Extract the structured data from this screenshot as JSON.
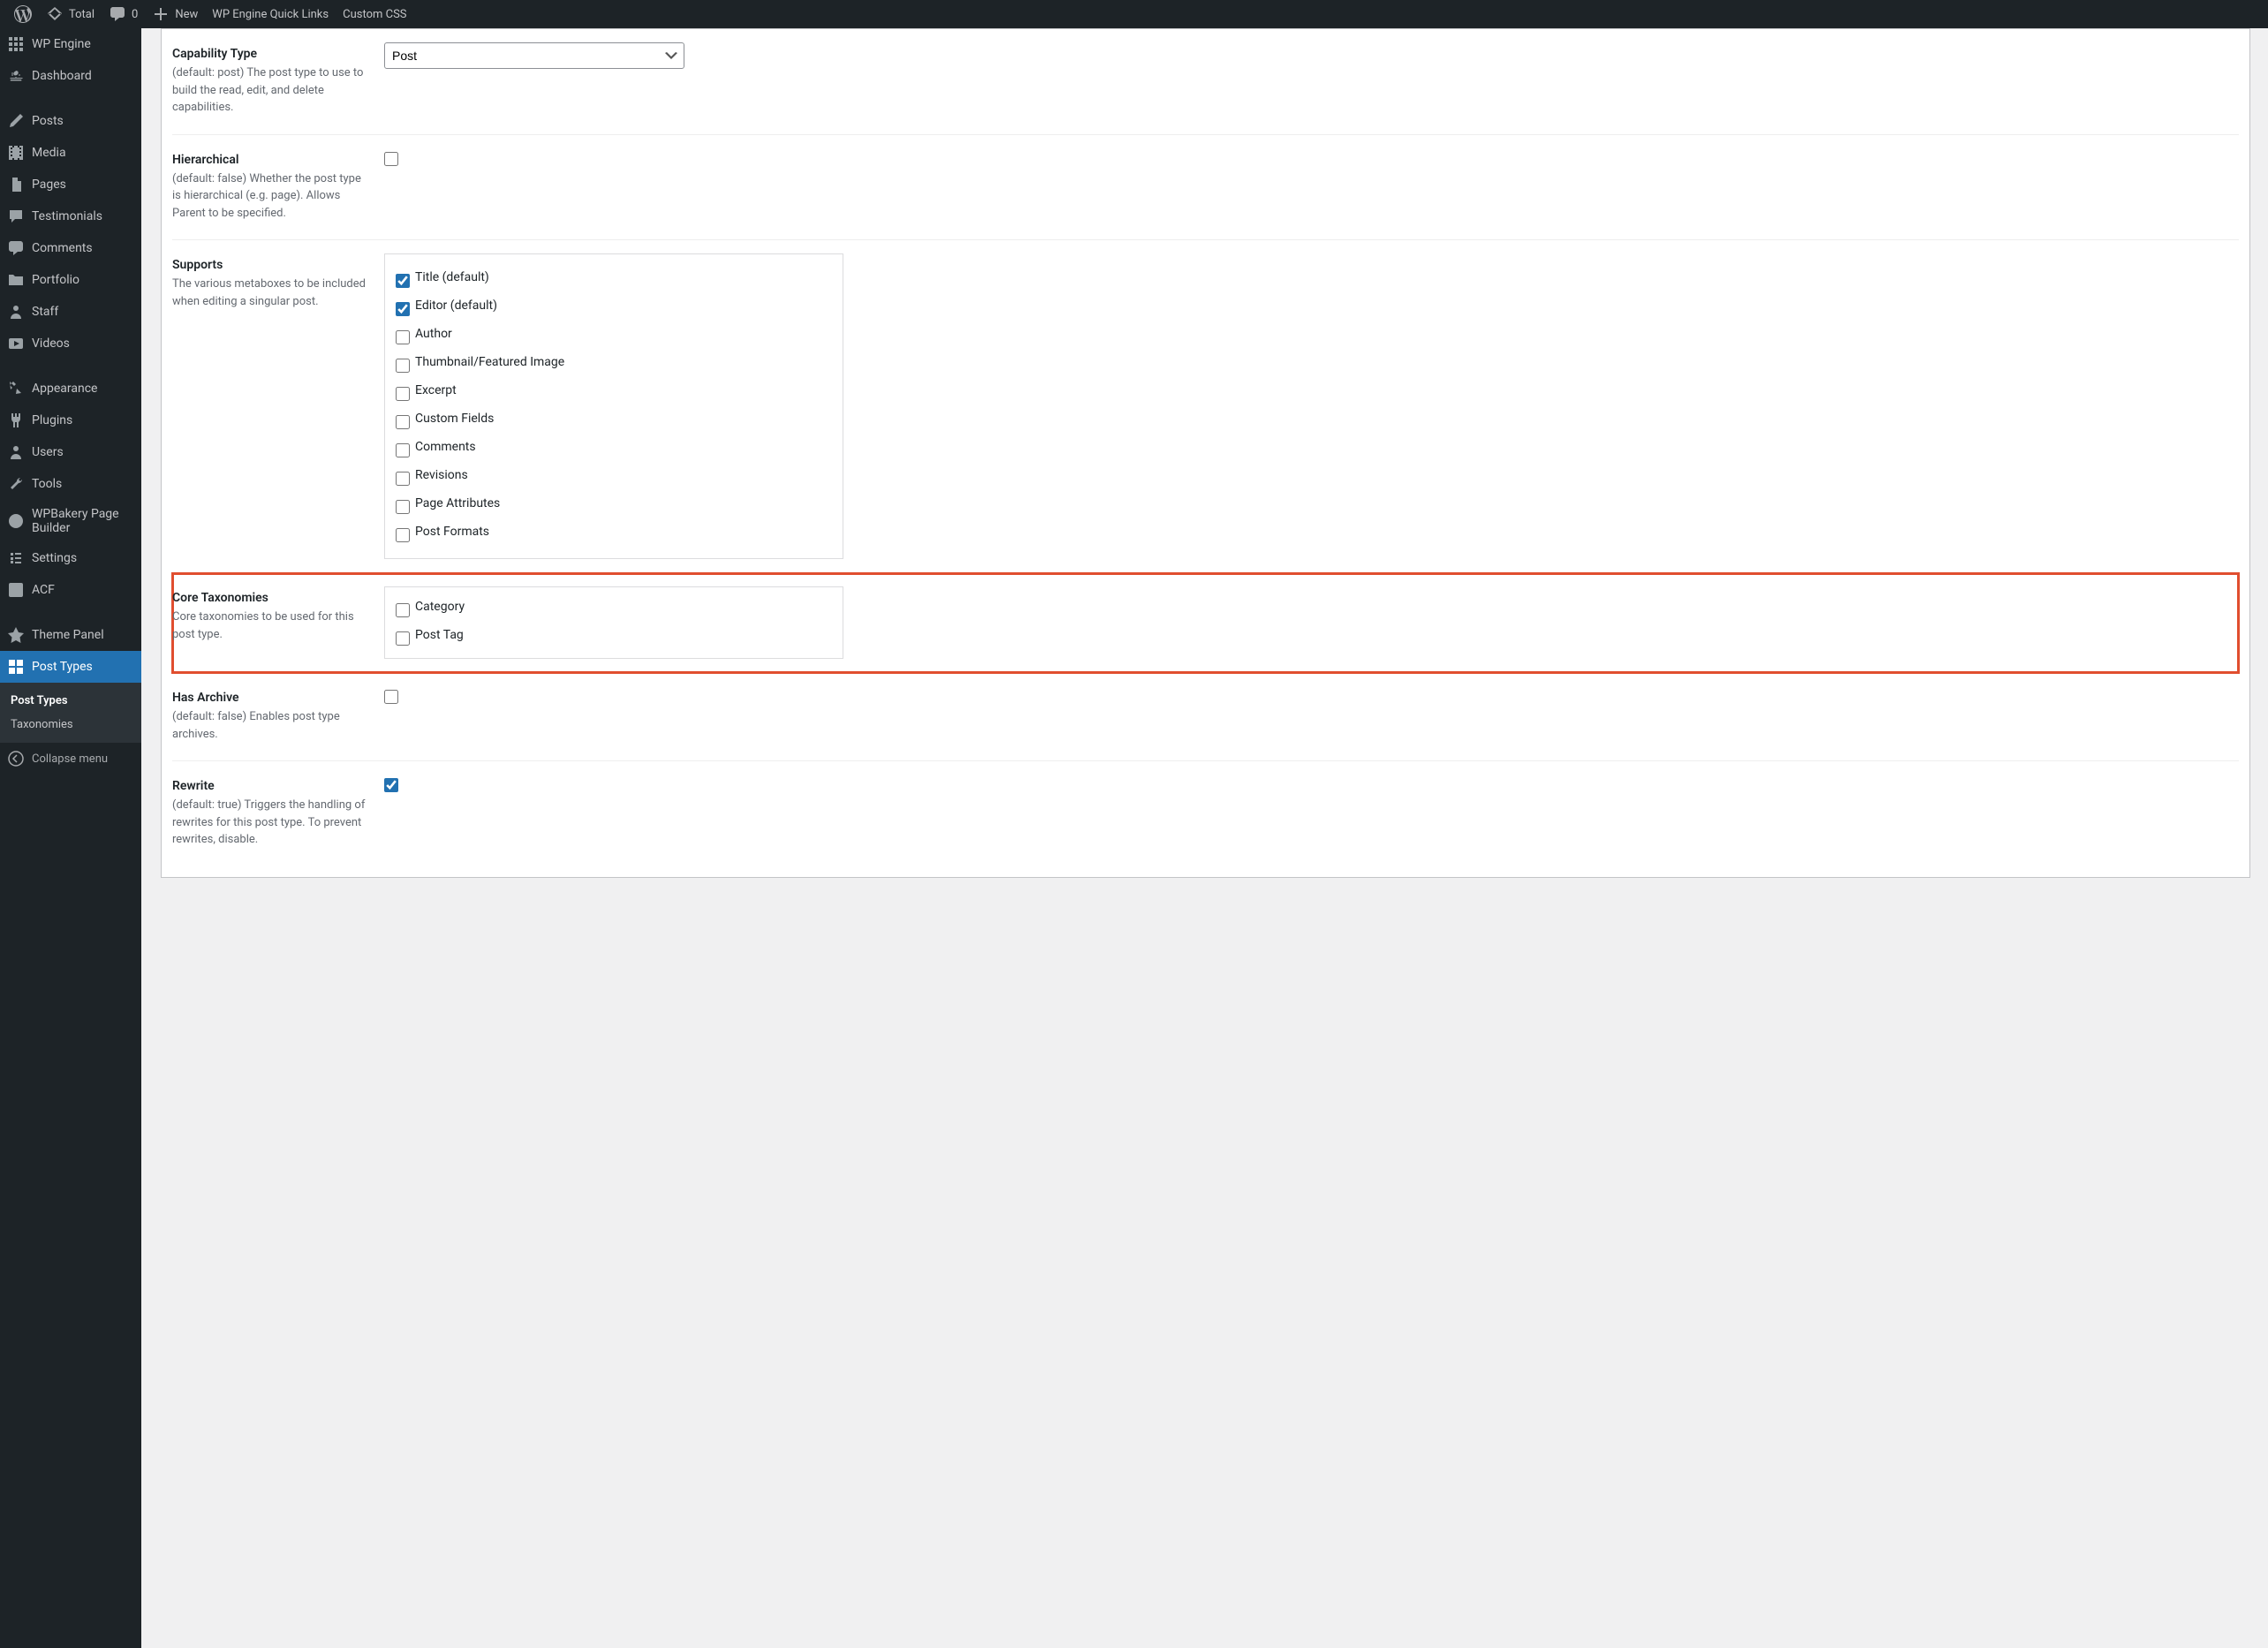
{
  "adminbar": {
    "site": "Total",
    "comments": "0",
    "new": "New",
    "quicklinks": "WP Engine Quick Links",
    "customcss": "Custom CSS"
  },
  "menu": {
    "wpengine": "WP Engine",
    "dashboard": "Dashboard",
    "posts": "Posts",
    "media": "Media",
    "pages": "Pages",
    "testimonials": "Testimonials",
    "comments": "Comments",
    "portfolio": "Portfolio",
    "staff": "Staff",
    "videos": "Videos",
    "appearance": "Appearance",
    "plugins": "Plugins",
    "users": "Users",
    "tools": "Tools",
    "wpbakery": "WPBakery Page Builder",
    "settings": "Settings",
    "acf": "ACF",
    "themepanel": "Theme Panel",
    "posttypes": "Post Types",
    "sub_posttypes": "Post Types",
    "sub_taxonomies": "Taxonomies",
    "collapse": "Collapse menu"
  },
  "fields": {
    "cap_label": "Capability Type",
    "cap_desc": "(default: post) The post type to use to build the read, edit, and delete capabilities.",
    "cap_value": "Post",
    "hier_label": "Hierarchical",
    "hier_desc": "(default: false) Whether the post type is hierarchical (e.g. page). Allows Parent to be specified.",
    "supports_label": "Supports",
    "supports_desc": "The various metaboxes to be included when editing a singular post.",
    "supports": {
      "title": "Title (default)",
      "editor": "Editor (default)",
      "author": "Author",
      "thumbnail": "Thumbnail/Featured Image",
      "excerpt": "Excerpt",
      "customfields": "Custom Fields",
      "comments": "Comments",
      "revisions": "Revisions",
      "pageattr": "Page Attributes",
      "postformats": "Post Formats"
    },
    "coretax_label": "Core Taxonomies",
    "coretax_desc": "Core taxonomies to be used for this post type.",
    "coretax": {
      "category": "Category",
      "posttag": "Post Tag"
    },
    "archive_label": "Has Archive",
    "archive_desc": "(default: false) Enables post type archives.",
    "rewrite_label": "Rewrite",
    "rewrite_desc": "(default: true) Triggers the handling of rewrites for this post type. To prevent rewrites, disable."
  }
}
